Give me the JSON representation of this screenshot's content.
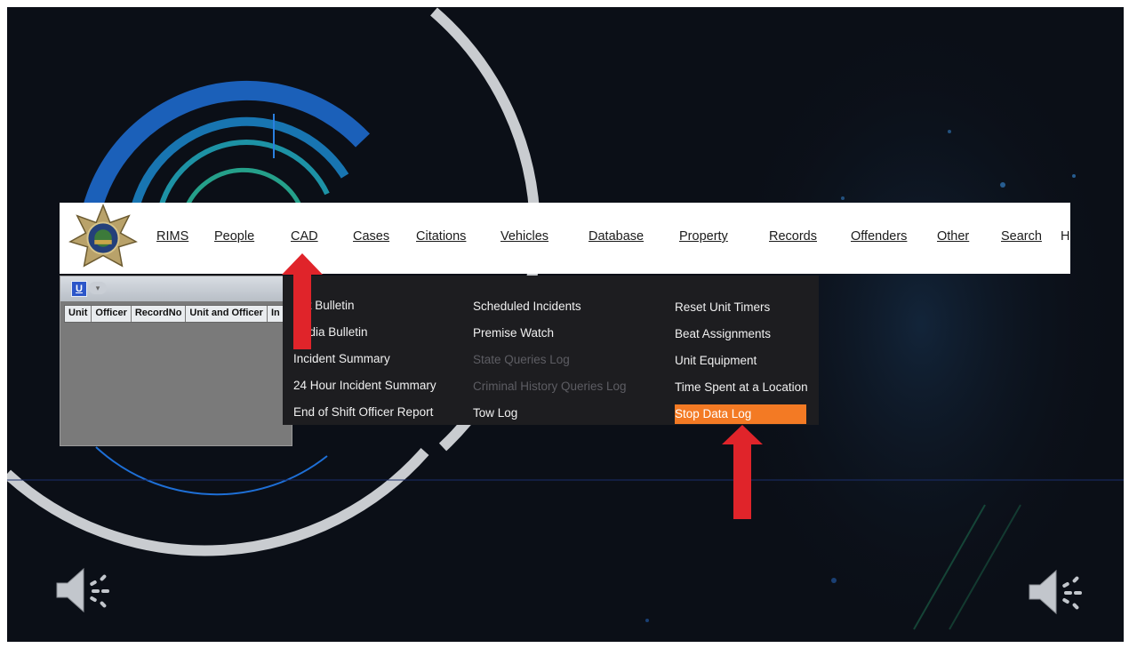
{
  "colors": {
    "slide_background": "#0b0f17",
    "highlight": "#f37a24",
    "arrow": "#e0242a",
    "menu_background": "#1d1d20",
    "navbar_background": "#ffffff"
  },
  "nav": {
    "logo": "police-star-badge",
    "items": [
      "RIMS",
      "People",
      "CAD",
      "Cases",
      "Citations",
      "Vehicles",
      "Database",
      "Property",
      "Records",
      "Offenders",
      "Other",
      "Search",
      "H"
    ]
  },
  "app_window": {
    "u_button": "U",
    "columns": [
      "Unit",
      "Officer",
      "RecordNo",
      "Unit and Officer",
      "In"
    ]
  },
  "cad_menu": {
    "column1": [
      "ift Bulletin",
      "edia Bulletin",
      "Incident Summary",
      "24 Hour Incident Summary",
      "End of Shift Officer Report"
    ],
    "column2": [
      "Scheduled Incidents",
      "Premise Watch",
      "State Queries Log",
      "Criminal History Queries Log",
      "Tow Log"
    ],
    "column3": [
      "Reset Unit Timers",
      "Beat Assignments",
      "Unit Equipment",
      "Time Spent at a Location",
      "Stop Data Log"
    ],
    "disabled": [
      "State Queries Log",
      "Criminal History Queries Log"
    ],
    "highlighted": "Stop Data Log"
  },
  "icons": [
    "speaker-left-icon",
    "speaker-right-icon",
    "arrow-up-icon"
  ]
}
